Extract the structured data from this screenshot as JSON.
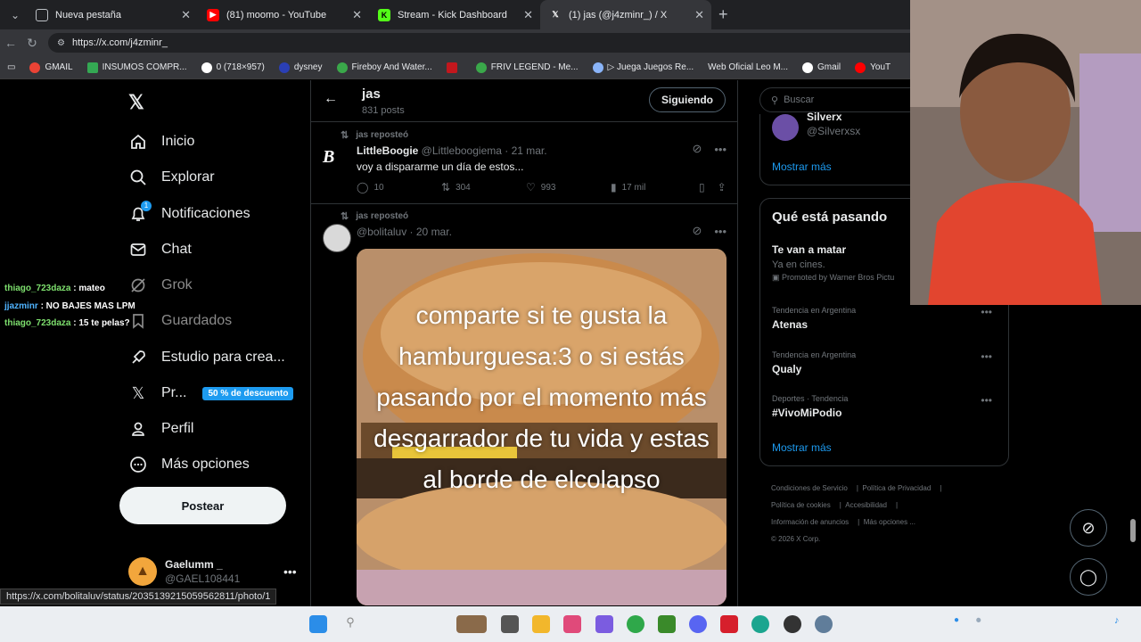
{
  "browser": {
    "tabs": [
      {
        "title": "Nueva pestaña",
        "active": false
      },
      {
        "title": "(81) moomo - YouTube",
        "active": false
      },
      {
        "title": "Stream - Kick Dashboard",
        "active": false
      },
      {
        "title": "(1) jas (@j4zminr_) / X",
        "active": true
      }
    ],
    "url": "https://x.com/j4zminr_",
    "bookmarks": [
      "GMAIL",
      "INSUMOS COMPR...",
      "0 (718×957)",
      "dysney",
      "Fireboy And Water...",
      "FRIV LEGEND - Me...",
      "▷ Juega Juegos Re...",
      "Web Oficial Leo M...",
      "Gmail",
      "YouT"
    ],
    "status_url": "https://x.com/bolitaluv/status/2035139215059562811/photo/1"
  },
  "nav": {
    "items": [
      {
        "label": "Inicio",
        "icon": "home-icon"
      },
      {
        "label": "Explorar",
        "icon": "search-icon"
      },
      {
        "label": "Notificaciones",
        "icon": "bell-icon",
        "badge": "1"
      },
      {
        "label": "Chat",
        "icon": "mail-icon"
      },
      {
        "label": "Grok",
        "icon": "grok-icon"
      },
      {
        "label": "Guardados",
        "icon": "bookmark-icon"
      },
      {
        "label": "Estudio para crea...",
        "icon": "rocket-icon"
      },
      {
        "label": "Pr...",
        "icon": "x-premium-icon",
        "promo": "50 % de descuento"
      },
      {
        "label": "Perfil",
        "icon": "person-icon"
      },
      {
        "label": "Más opciones",
        "icon": "more-circle-icon"
      }
    ],
    "post_button": "Postear",
    "account": {
      "name": "Gaelumm _",
      "handle": "@GAEL108441"
    }
  },
  "stream_chat": [
    {
      "user": "thiago_723daza",
      "message": " : mateo"
    },
    {
      "user": "jjazminr",
      "message": " : NO BAJES MAS LPM"
    },
    {
      "user": "thiago_723daza",
      "message": " : 15 te pelas?"
    }
  ],
  "profile_header": {
    "name": "jas",
    "posts": "831 posts",
    "follow_label": "Siguiendo"
  },
  "tweets": [
    {
      "repost_label": "jas reposteó",
      "author": "LittleBoogie",
      "handle": "@Littleboogiema",
      "date": " · 21 mar.",
      "text": "voy a dispararme un día de estos...",
      "replies": "10",
      "reposts": "304",
      "likes": "993",
      "views": "17 mil"
    },
    {
      "repost_label": "jas reposteó",
      "author": "",
      "handle": "@bolitaluv",
      "date": " · 20 mar.",
      "image_caption": "comparte si te gusta la hamburguesa:3 o si estás pasando por el momento más desgarrador de tu vida y estas al borde de elcolapso"
    }
  ],
  "sidebar": {
    "search_placeholder": "Buscar",
    "who_to_follow": {
      "name": "Silverx",
      "handle": "@Silverxsx",
      "show_more": "Mostrar más"
    },
    "trending": {
      "title": "Qué está pasando",
      "items": [
        {
          "label": "",
          "name": "Te van a matar",
          "sub": "Ya en cines.",
          "promo": "Promoted by Warner Bros Pictu"
        },
        {
          "label": "Tendencia en Argentina",
          "name": "Atenas"
        },
        {
          "label": "Tendencia en Argentina",
          "name": "Qualy"
        },
        {
          "label": "Deportes · Tendencia",
          "name": "#VivoMiPodio"
        }
      ],
      "show_more": "Mostrar más"
    },
    "footer": {
      "links": [
        "Condiciones de Servicio",
        "Política de Privacidad",
        "Política de cookies",
        "Accesibilidad",
        "Información de anuncios",
        "Más opciones ..."
      ],
      "copyright": "© 2026 X Corp."
    }
  },
  "colors": {
    "accent": "#1d9bf0",
    "background": "#000000",
    "border": "#2f3336",
    "muted": "#71767b"
  }
}
